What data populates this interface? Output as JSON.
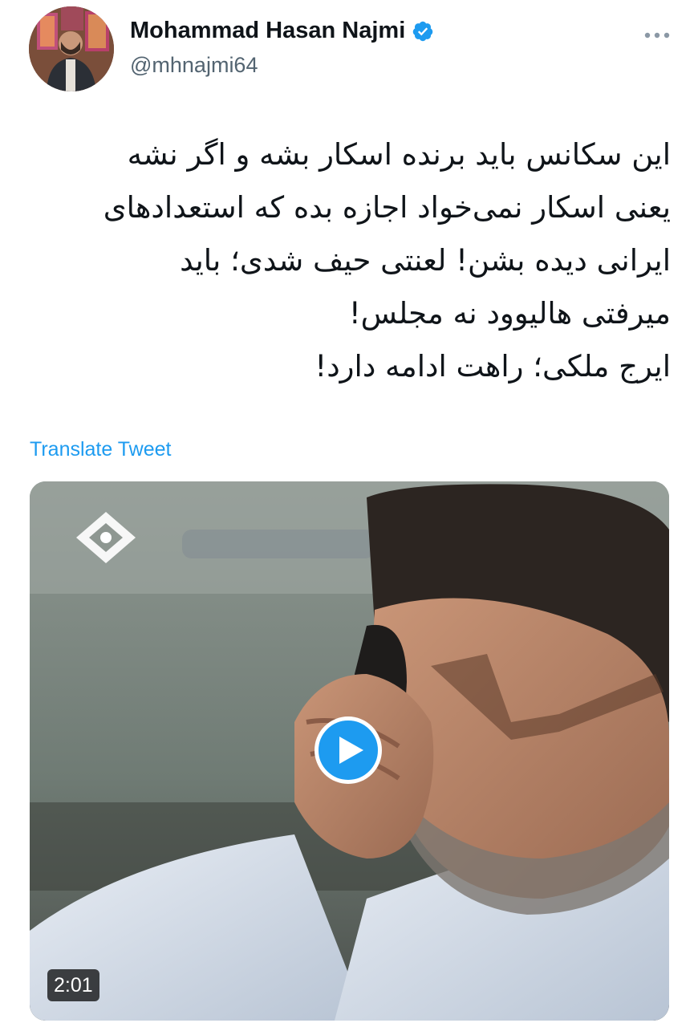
{
  "tweet": {
    "author": {
      "name": "Mohammad Hasan Najmi",
      "handle": "@mhnajmi64",
      "verified": true
    },
    "text": "این سکانس باید برنده اسکار بشه و اگر نشه\nیعنی اسکار نمی‌خواد اجازه بده که استعدادهای\nایرانی دیده بشن! لعنتی حیف شدی؛ باید\nمیرفتی هالیوود نه مجلس!\nایرج ملکی؛ راهت ادامه دارد!",
    "translate_label": "Translate Tweet",
    "video": {
      "duration": "2:01"
    }
  },
  "icons": {
    "more": "more-horizontal-icon",
    "verified": "verified-badge-icon",
    "play": "play-icon",
    "channel_logo": "channel-logo-icon"
  },
  "colors": {
    "accent": "#1d9bf0",
    "text": "#0f1419",
    "secondary": "#536471"
  }
}
